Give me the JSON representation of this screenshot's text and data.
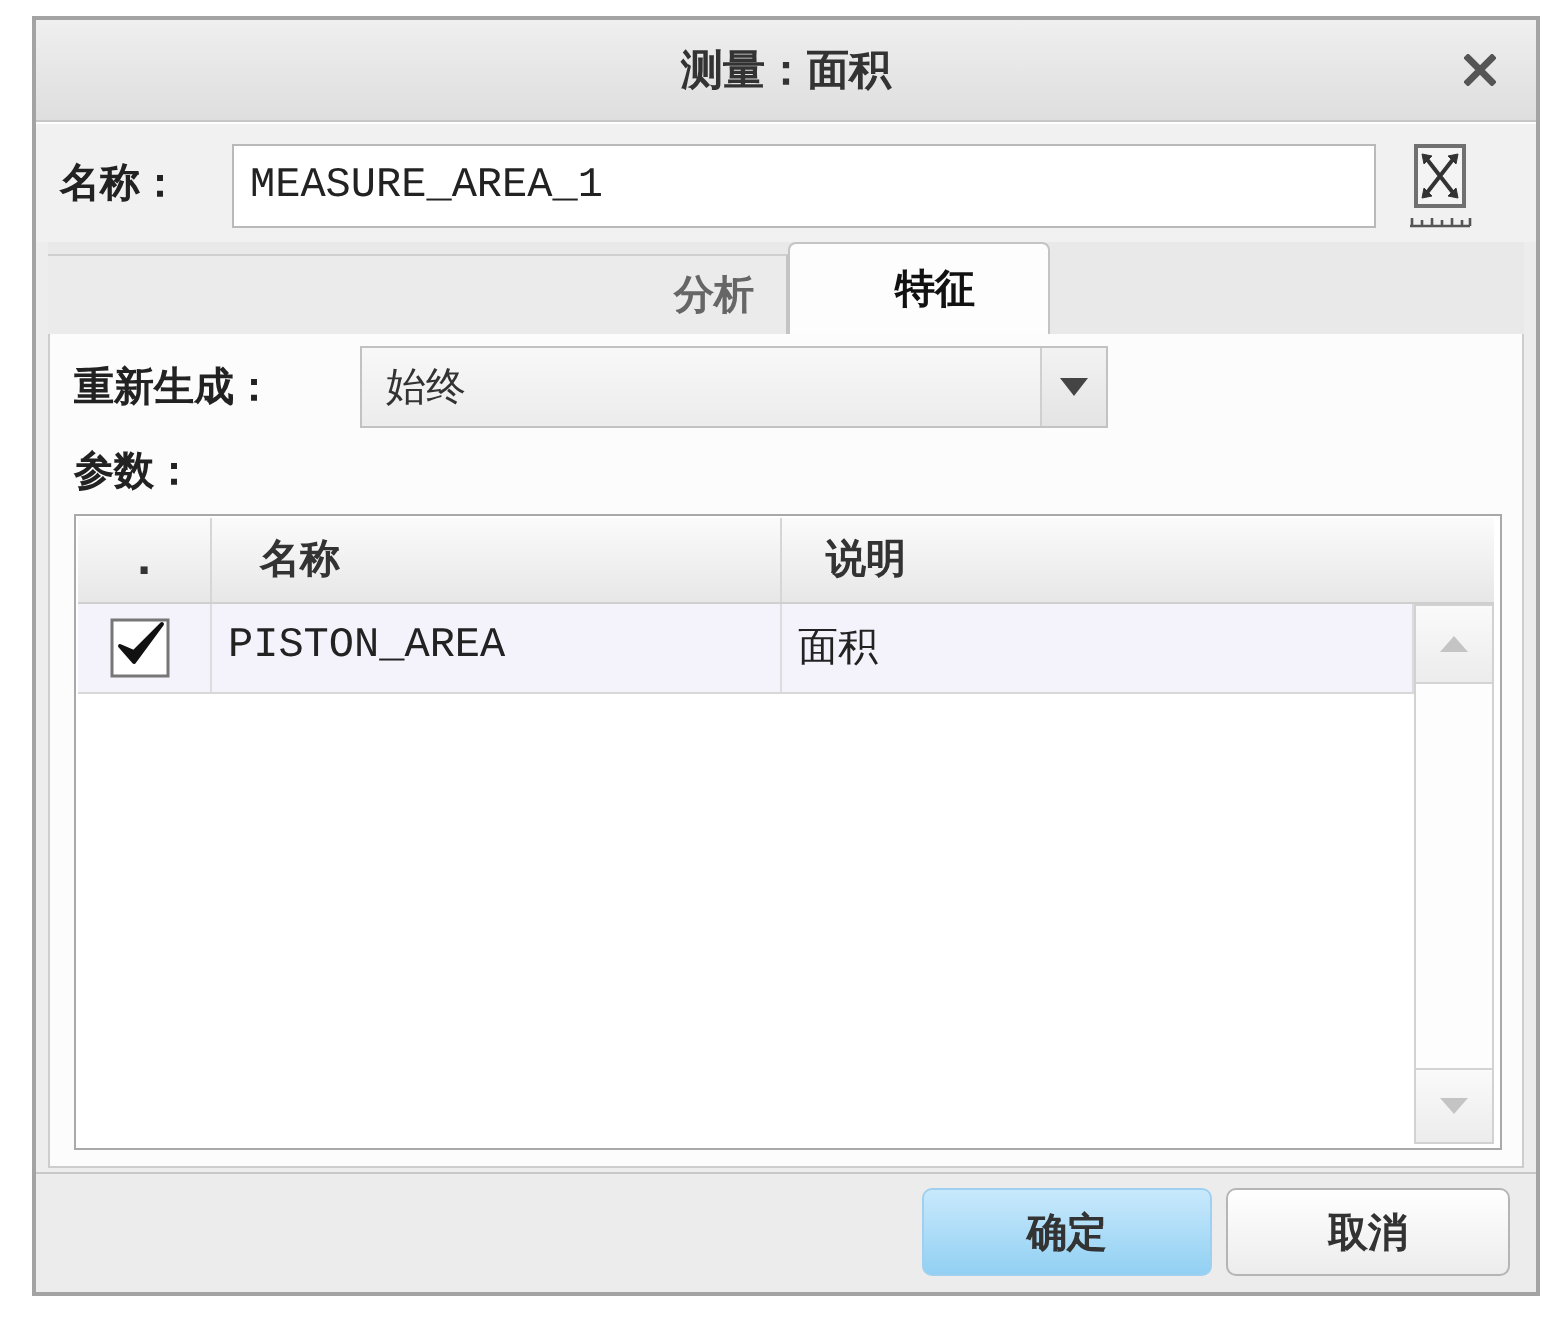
{
  "window": {
    "title": "测量：面积"
  },
  "name": {
    "label": "名称：",
    "value": "MEASURE_AREA_1"
  },
  "tabs": [
    {
      "label": "分析",
      "selected": false
    },
    {
      "label": "特征",
      "selected": true
    }
  ],
  "regenerate": {
    "label": "重新生成：",
    "value": "始终"
  },
  "parameters": {
    "label": "参数：",
    "columns": [
      ".",
      "名称",
      "说明"
    ],
    "rows": [
      {
        "checked": true,
        "selected": true,
        "name": "PISTON_AREA",
        "description": "面积"
      }
    ]
  },
  "buttons": [
    {
      "label": "确定",
      "kind": "primary"
    },
    {
      "label": "取消",
      "kind": "secondary"
    }
  ]
}
